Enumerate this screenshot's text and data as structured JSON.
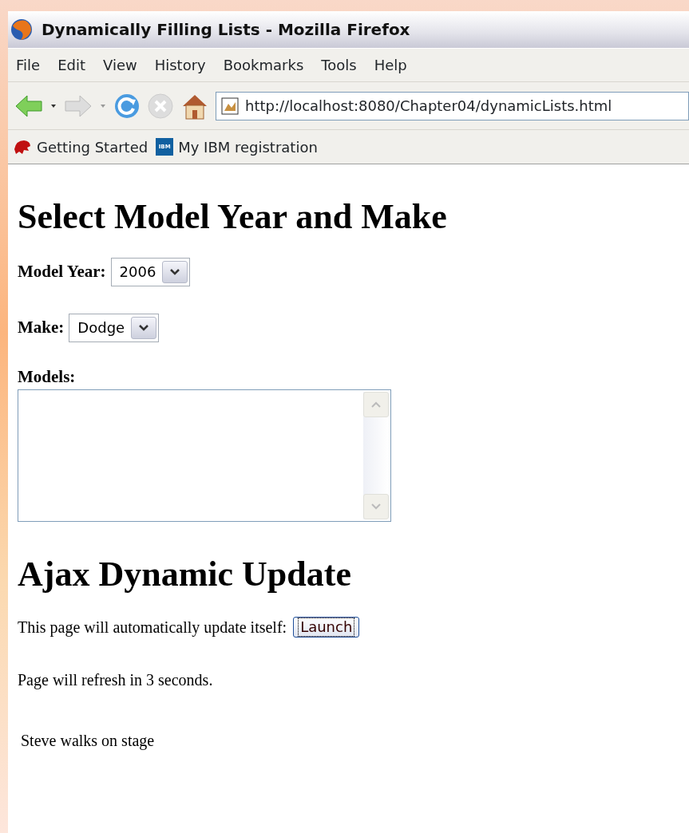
{
  "window": {
    "title": "Dynamically Filling Lists - Mozilla Firefox"
  },
  "menu": [
    "File",
    "Edit",
    "View",
    "History",
    "Bookmarks",
    "Tools",
    "Help"
  ],
  "address_bar": {
    "value": "http://localhost:8080/Chapter04/dynamicLists.html"
  },
  "bookmarks": [
    {
      "label": "Getting Started",
      "kind": "firefox"
    },
    {
      "label": "My IBM registration",
      "kind": "ibm",
      "icon_text": "IBM"
    }
  ],
  "page": {
    "heading_1": "Select Model Year and Make",
    "fields": [
      {
        "label": "Model Year:",
        "value": "2006"
      },
      {
        "label": "Make:",
        "value": "Dodge"
      }
    ],
    "models_label": "Models:",
    "heading_2": "Ajax Dynamic Update",
    "update_text": "This page will automatically update itself:",
    "launch_button": {
      "label": "Launch",
      "focused": true
    },
    "refresh_text": "Page will refresh in 3 seconds.",
    "status_text": "Steve walks on stage"
  }
}
